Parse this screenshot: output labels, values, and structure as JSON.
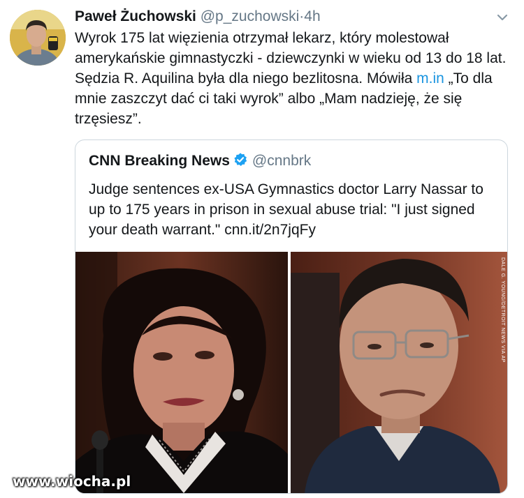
{
  "tweet": {
    "author_name": "Paweł Żuchowski",
    "handle": "@p_zuchowski",
    "separator": "·",
    "time": "4h",
    "text_part1": "Wyrok 175 lat więzienia otrzymał lekarz, który molestował amerykańskie gimnastyczki - dziewczynki w wieku od 13 do 18 lat. Sędzia R. Aquilina była dla niego bezlitosna. Mówiła ",
    "text_link": "m.in",
    "text_part2": " „To dla mnie zaszczyt dać ci taki wyrok” albo „Mam nadzieję, że się trzęsiesz”."
  },
  "quoted_tweet": {
    "author_name": "CNN Breaking News",
    "handle": "@cnnbrk",
    "text": "Judge sentences ex-USA Gymnastics doctor Larry Nassar to up to 175 years in prison in sexual abuse trial: \"I just signed your death warrant.\" cnn.it/2n7jqFy",
    "photo_credit": "DALE G. YOUNG/DETROIT NEWS VIA AP"
  },
  "watermark": "www.wiocha.pl",
  "colors": {
    "link": "#1b95e0",
    "secondary_text": "#657786",
    "verified": "#1da1f2",
    "border": "#ccd6dd"
  },
  "icons": {
    "caret": "chevron-down-icon",
    "verified": "verified-badge-icon"
  }
}
